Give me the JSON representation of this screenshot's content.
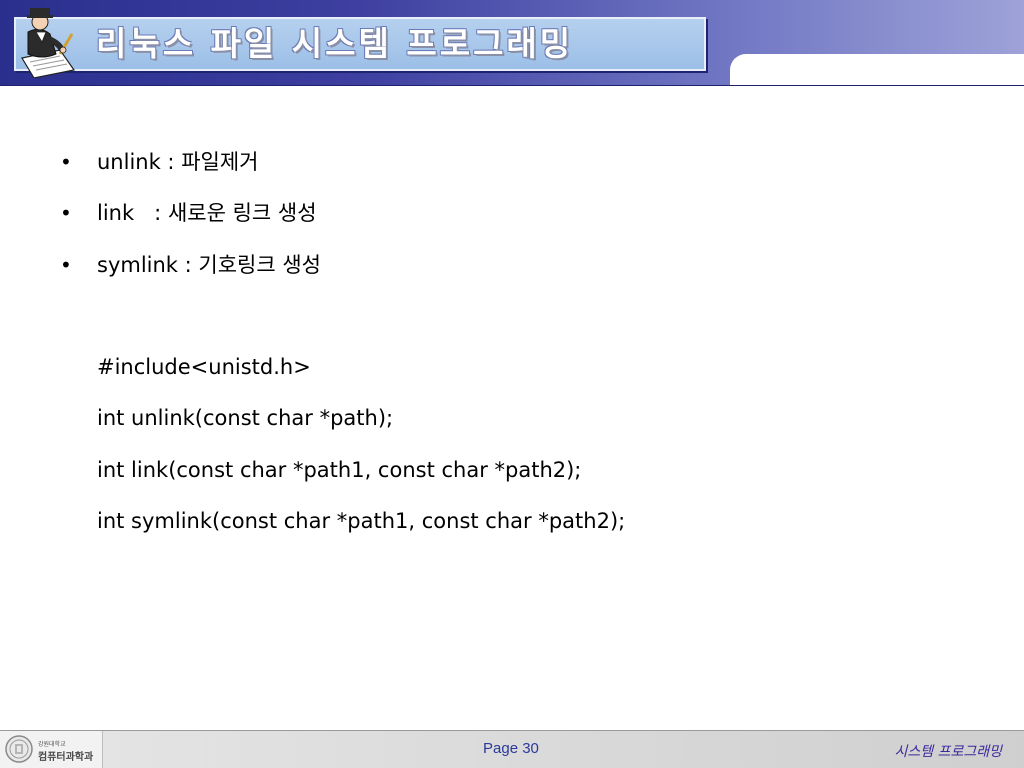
{
  "slide": {
    "title": "리눅스 파일 시스템 프로그래밍"
  },
  "bullets": [
    {
      "term": "unlink :",
      "desc": "파일제거"
    },
    {
      "term": "link   :",
      "desc": "새로운 링크 생성"
    },
    {
      "term": "symlink :",
      "desc": "기호링크 생성"
    }
  ],
  "code": [
    "#include<unistd.h>",
    "int unlink(const char *path);",
    "int link(const char *path1, const char *path2);",
    "int symlink(const char *path1, const char *path2);"
  ],
  "footer": {
    "university": "강원대학교",
    "department": "컴퓨터과학과",
    "page": "Page 30",
    "course": "시스템  프로그래밍"
  },
  "icons": {
    "logo": "writer-figure-icon",
    "seal": "university-seal-icon"
  },
  "colors": {
    "header_dark": "#2a2f8e",
    "header_light": "#9ea2d8",
    "title_box": "#a8c6ea",
    "page_number": "#2b3a9a",
    "course_label": "#3a2a9c"
  }
}
